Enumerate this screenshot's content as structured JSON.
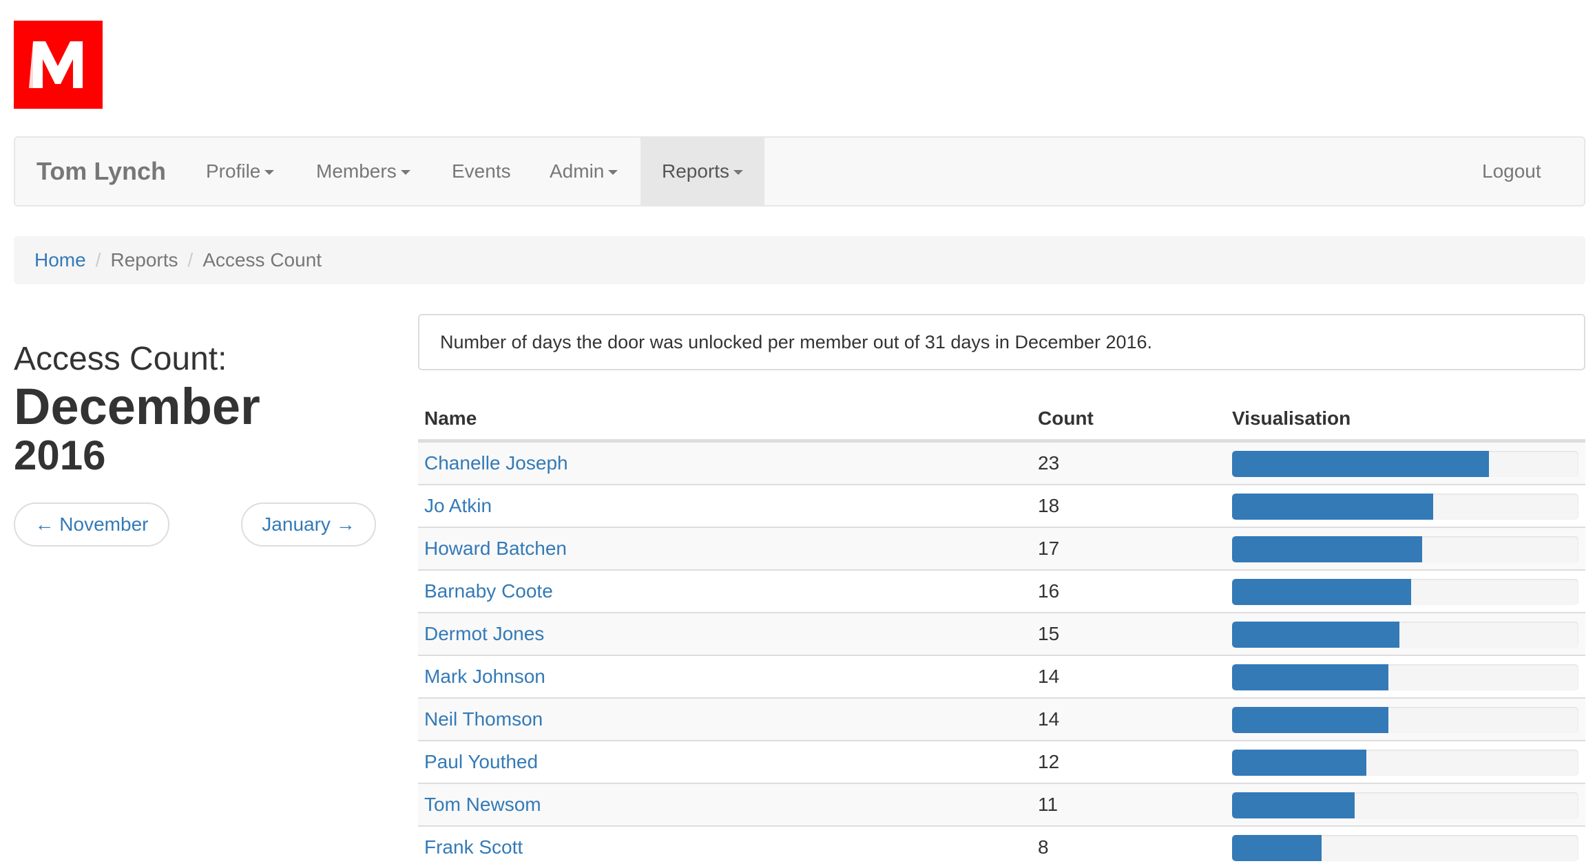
{
  "brand": {
    "logo_icon": "m-logo-icon",
    "accent": "#ff0000"
  },
  "navbar": {
    "user_name": "Tom Lynch",
    "items": [
      {
        "label": "Profile",
        "dropdown": true
      },
      {
        "label": "Members",
        "dropdown": true
      },
      {
        "label": "Events",
        "dropdown": false
      },
      {
        "label": "Admin",
        "dropdown": true
      },
      {
        "label": "Reports",
        "dropdown": true,
        "active": true
      }
    ],
    "logout": "Logout"
  },
  "breadcrumb": {
    "home": "Home",
    "reports": "Reports",
    "current": "Access Count",
    "separator": "/"
  },
  "heading": {
    "line1": "Access Count:",
    "month": "December",
    "year": "2016"
  },
  "pager": {
    "prev": "← November",
    "next": "January →"
  },
  "info": "Number of days the door was unlocked per member out of 31 days in December 2016.",
  "table": {
    "headers": {
      "name": "Name",
      "count": "Count",
      "visualisation": "Visualisation"
    },
    "max_days": 31,
    "bar_color": "#337ab7",
    "rows": [
      {
        "name": "Chanelle Joseph",
        "count": 23
      },
      {
        "name": "Jo Atkin",
        "count": 18
      },
      {
        "name": "Howard Batchen",
        "count": 17
      },
      {
        "name": "Barnaby Coote",
        "count": 16
      },
      {
        "name": "Dermot Jones",
        "count": 15
      },
      {
        "name": "Mark Johnson",
        "count": 14
      },
      {
        "name": "Neil Thomson",
        "count": 14
      },
      {
        "name": "Paul Youthed",
        "count": 12
      },
      {
        "name": "Tom Newsom",
        "count": 11
      },
      {
        "name": "Frank Scott",
        "count": 8
      }
    ]
  }
}
